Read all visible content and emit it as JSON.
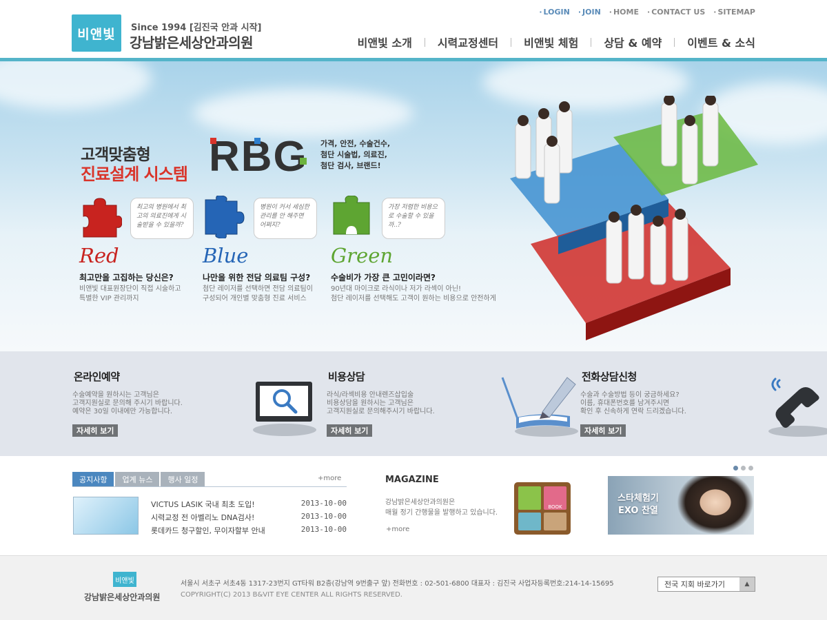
{
  "header": {
    "logo_text": "비앤빛",
    "since": "Since 1994 [김진국 안과 시작]",
    "clinic_name": "강남밝은세상안과의원",
    "util_nav": [
      "LOGIN",
      "JOIN",
      "HOME",
      "CONTACT US",
      "SITEMAP"
    ],
    "main_nav": [
      "비앤빛 소개",
      "시력교정센터",
      "비앤빛 체험",
      "상담 & 예약",
      "이벤트 & 소식"
    ]
  },
  "hero": {
    "title_line1": "고객맞춤형",
    "title_line2": "진료설계 시스템",
    "rbg_logo": "RBG",
    "rbg_desc": [
      "가격, 안전, 수술건수,",
      "첨단 시술법, 의료진,",
      "첨단 검사, 브랜드!"
    ],
    "pieces": [
      {
        "word": "Red",
        "color": "#c8231f",
        "bubble": "최고의 병원에서 최고의 의료진에게 시술받을 수 있을까?",
        "heading": "최고만을 고집하는 당신은?",
        "desc": [
          "비앤빛 대표원장단이 직접 시술하고",
          "특별한 VIP 관리까지"
        ]
      },
      {
        "word": "Blue",
        "color": "#2565b6",
        "bubble": "병원이 커서 세심한 관리를 안 해주면 어쩌지?",
        "heading": "나만을 위한 전담 의료팀 구성?",
        "desc": [
          "첨단 레이저를 선택하면 전담 의료팀이",
          "구성되어 개인별 맞춤형 진료 서비스"
        ]
      },
      {
        "word": "Green",
        "color": "#5ea532",
        "bubble": "가장 저렴한 비용으로 수술할 수 있을까..?",
        "heading": "수술비가 가장 큰 고민이라면?",
        "desc": [
          "90년대 마이크로 라식이나 저가 라섹이 아닌!",
          "첨단 레이저를 선택해도 고객이 원하는 비용으로 안전하게"
        ]
      }
    ]
  },
  "services": [
    {
      "title": "온라인예약",
      "desc": [
        "수술예약을 원하시는 고객님은",
        "고객지원실로 문의해 주시기 바랍니다.",
        "예약은 30일 이내에만 가능합니다."
      ],
      "button": "자세히 보기",
      "icon": "monitor-search-icon"
    },
    {
      "title": "비용상담",
      "desc": [
        "라식/라섹비용 안내렌즈삽입술",
        "비용상담을 원하시는 고객님은",
        "고객지원실로 문의해주시기 바랍니다."
      ],
      "button": "자세히 보기",
      "icon": "pen-book-icon"
    },
    {
      "title": "전화상담신청",
      "desc": [
        "수술과 수술방법 등이 궁금하세요?",
        "이름, 휴대폰번호를 남겨주시면",
        "확인 후 신속하게 연락 드리겠습니다."
      ],
      "button": "자세히 보기",
      "icon": "phone-icon"
    }
  ],
  "news": {
    "tabs": [
      "공지사항",
      "업계 뉴스",
      "행사 일정"
    ],
    "more": "+more",
    "items": [
      {
        "title": "VICTUS LASIK 국내 최초 도입!",
        "date": "2013-10-00"
      },
      {
        "title": "시력교정 전 아벨리노 DNA검사!",
        "date": "2013-10-00"
      },
      {
        "title": "롯데카드 청구할인, 무이자할부 안내",
        "date": "2013-10-00"
      }
    ]
  },
  "magazine": {
    "title": "MAGAZINE",
    "desc": [
      "강남밝은세상안과의원은",
      "매월 정기 간행물을 발행하고 있습니다."
    ],
    "more": "+more",
    "book_label": "BOOK"
  },
  "promo": {
    "text": [
      "스타체험기",
      "EXO 찬열"
    ]
  },
  "footer": {
    "logo_text": "비앤빛",
    "name": "강남밝은세상안과의원",
    "address": "서울시 서초구 서초4동 1317-23번지 GT타워 B2층(강남역 9번출구 앞)    전화번호 : 02-501-6800    대표자 : 김진국    사업자등록번호:214-14-15695",
    "copyright": "COPYRIGHT(C) 2013   B&VIT EYE CENTER  ALL RIGHTS RESERVED.",
    "branch_select": "전국 지회 바로가기"
  }
}
